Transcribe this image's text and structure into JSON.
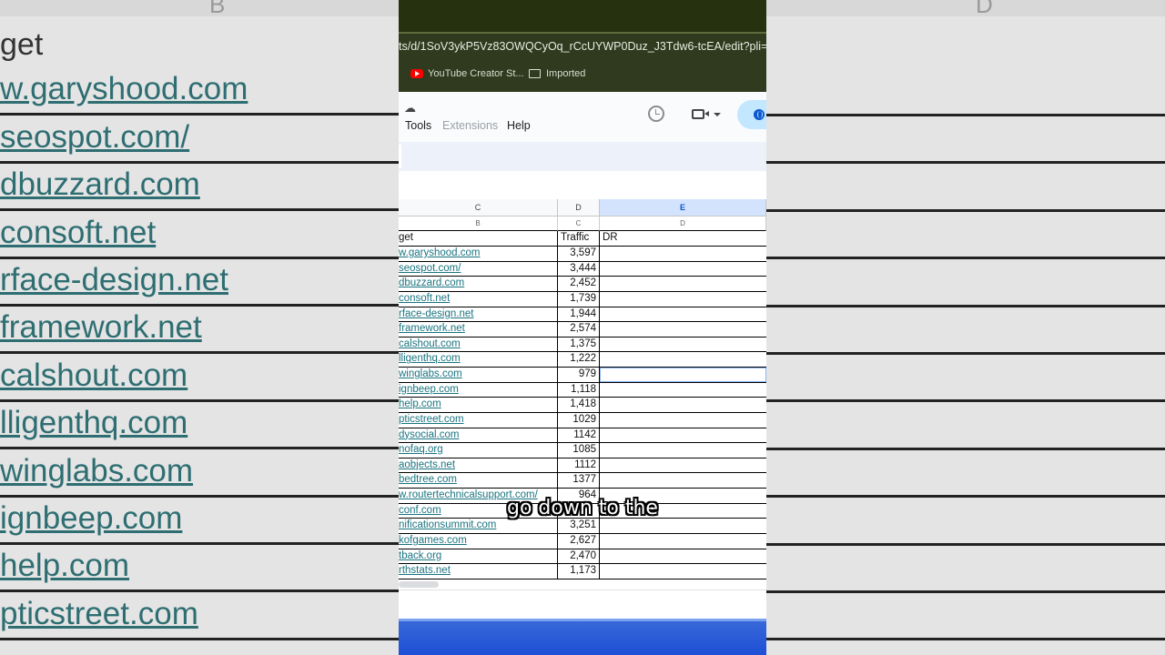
{
  "background": {
    "col_letters": [
      "B",
      "D"
    ],
    "header": "get",
    "rows": [
      "w.garyshood.com",
      "seospot.com/",
      "dbuzzard.com",
      "consoft.net",
      "rface-design.net",
      "framework.net",
      "calshout.com",
      "lligenthq.com",
      "winglabs.com",
      "ignbeep.com",
      "help.com",
      "pticstreet.com"
    ]
  },
  "browser": {
    "url": "ts/d/1SoV3ykP5Vz83OWQCyOq_rCcUYWP0Duz_J3Tdw6-tcEA/edit?pli=1&gid=8",
    "bookmarks": [
      {
        "label": "YouTube Creator St...",
        "icon": "youtube-icon"
      },
      {
        "label": "Imported",
        "icon": "folder-icon"
      }
    ]
  },
  "menu": {
    "items": [
      {
        "label": "Tools",
        "color": "#202124"
      },
      {
        "label": "Extensions",
        "color": "#9aa0a6"
      },
      {
        "label": "Help",
        "color": "#202124"
      }
    ]
  },
  "sheet": {
    "col_letters": [
      "C",
      "D",
      "E"
    ],
    "sub_letters": [
      "B",
      "C",
      "D"
    ],
    "selected_col": "E",
    "headers": {
      "target": "get",
      "traffic": "Traffic",
      "dr": "DR"
    },
    "rows": [
      {
        "target": "w.garyshood.com",
        "traffic": "3,597"
      },
      {
        "target": "seospot.com/",
        "traffic": "3,444"
      },
      {
        "target": "dbuzzard.com",
        "traffic": "2,452"
      },
      {
        "target": "consoft.net",
        "traffic": "1,739"
      },
      {
        "target": "rface-design.net",
        "traffic": "1,944"
      },
      {
        "target": "framework.net",
        "traffic": "2,574"
      },
      {
        "target": "calshout.com",
        "traffic": "1,375"
      },
      {
        "target": "lligenthq.com",
        "traffic": "1,222"
      },
      {
        "target": "winglabs.com",
        "traffic": "979"
      },
      {
        "target": "ignbeep.com",
        "traffic": "1,118"
      },
      {
        "target": "help.com",
        "traffic": "1,418"
      },
      {
        "target": "pticstreet.com",
        "traffic": "1029"
      },
      {
        "target": "dysocial.com",
        "traffic": "1142"
      },
      {
        "target": "nofaq.org",
        "traffic": "1085"
      },
      {
        "target": "aobjects.net",
        "traffic": "1112"
      },
      {
        "target": "bedtree.com",
        "traffic": "1377"
      },
      {
        "target": "w.routertechnicalsupport.com/",
        "traffic": "964"
      },
      {
        "target": "conf.com",
        "traffic": ""
      },
      {
        "target": "nificationsummit.com",
        "traffic": "3,251"
      },
      {
        "target": "kofgames.com",
        "traffic": "2,627"
      },
      {
        "target": "tback.org",
        "traffic": "2,470"
      },
      {
        "target": "rthstats.net",
        "traffic": "1,173"
      }
    ]
  },
  "caption": "go down to the"
}
